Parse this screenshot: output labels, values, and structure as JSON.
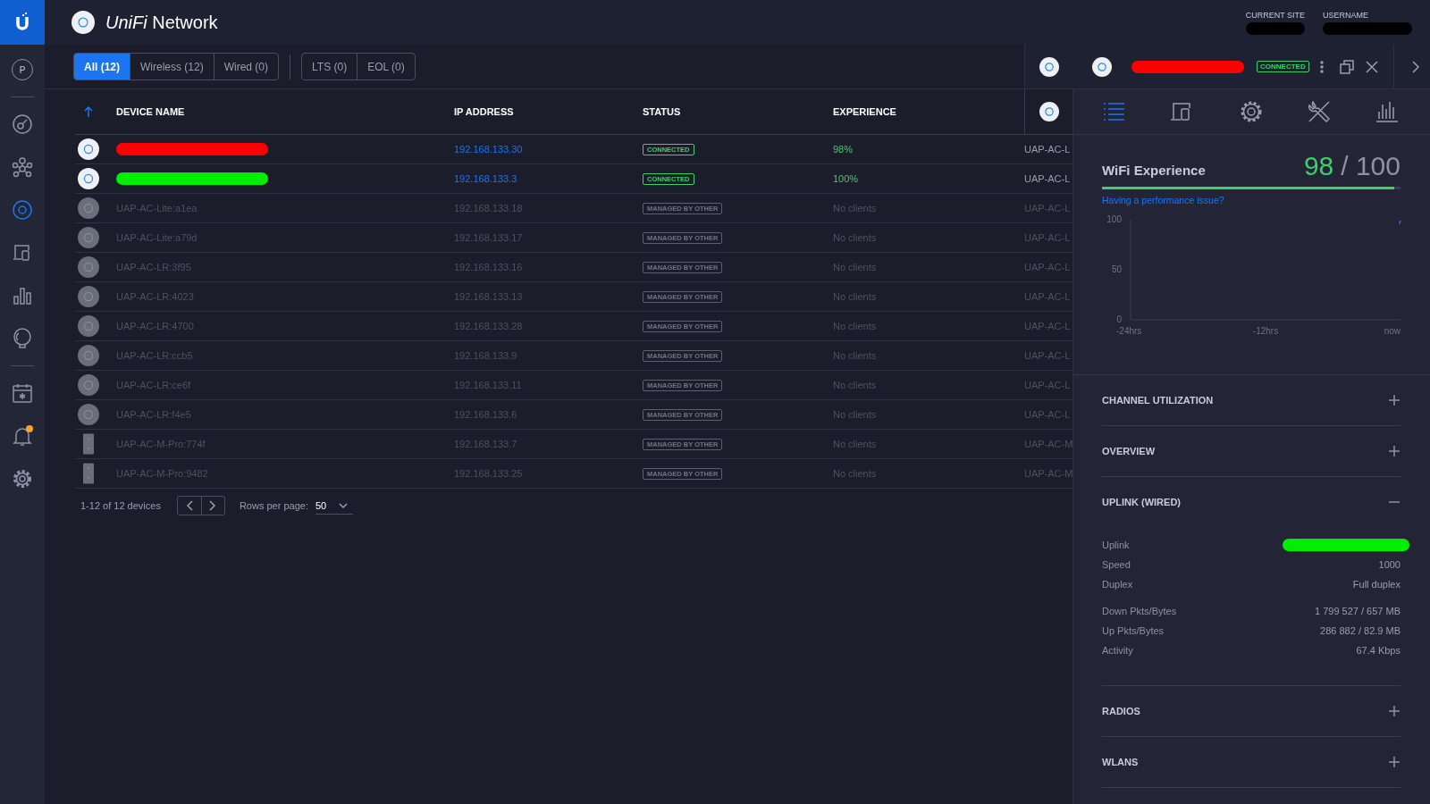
{
  "sidebar": {
    "items": [
      {
        "kind": "logo",
        "selected": false
      },
      {
        "kind": "avatar",
        "label": "P",
        "selected": false
      },
      {
        "kind": "divider"
      },
      {
        "kind": "dashboard",
        "selected": false
      },
      {
        "kind": "topology",
        "selected": false
      },
      {
        "kind": "devices",
        "selected": true
      },
      {
        "kind": "clients",
        "selected": false
      },
      {
        "kind": "statistics",
        "selected": false
      },
      {
        "kind": "insights",
        "selected": false
      },
      {
        "kind": "divider"
      },
      {
        "kind": "events",
        "selected": false
      },
      {
        "kind": "alarms",
        "selected": false,
        "alert": true
      },
      {
        "kind": "settings",
        "selected": false
      }
    ]
  },
  "header": {
    "product": "*UniFi* Network",
    "site": {
      "label": "CURRENT SITE",
      "redaction": {
        "color": "#000000"
      }
    },
    "user": {
      "label": "USERNAME",
      "redaction": {
        "color": "#000000"
      }
    }
  },
  "filters": {
    "groups": [
      [
        {
          "label": "All (12)",
          "selected": true
        },
        {
          "label": "Wireless (12)",
          "selected": false
        },
        {
          "label": "Wired (0)",
          "selected": false
        }
      ],
      [
        {
          "label": "LTS (0)",
          "selected": false
        },
        {
          "label": "EOL (0)",
          "selected": false
        }
      ]
    ]
  },
  "table": {
    "columns": [
      {
        "label": "DEVICE NAME",
        "sorted": true
      },
      {
        "label": "IP ADDRESS"
      },
      {
        "label": "STATUS"
      },
      {
        "label": "EXPERIENCE"
      },
      {
        "kind": "icon"
      }
    ],
    "rows": [
      {
        "kind": "round",
        "redaction": {
          "color": "#ff0000"
        },
        "ip": "192.168.133.30",
        "status": {
          "label": "CONNECTED",
          "kind": "connected"
        },
        "experience": "98%",
        "model": "UAP-AC-L"
      },
      {
        "kind": "round",
        "redaction": {
          "color": "#00ee00"
        },
        "ip": "192.168.133.3",
        "status": {
          "label": "CONNECTED",
          "kind": "connected"
        },
        "experience": "100%",
        "model": "UAP-AC-L"
      },
      {
        "kind": "round",
        "name": "UAP-AC-Lite:a1ea",
        "ip": "192.168.133.18",
        "status": {
          "label": "MANAGED BY OTHER",
          "kind": "managed"
        },
        "experience": "No clients",
        "model": "UAP-AC-L"
      },
      {
        "kind": "round",
        "name": "UAP-AC-Lite:a79d",
        "ip": "192.168.133.17",
        "status": {
          "label": "MANAGED BY OTHER",
          "kind": "managed"
        },
        "experience": "No clients",
        "model": "UAP-AC-L"
      },
      {
        "kind": "round",
        "name": "UAP-AC-LR:3f95",
        "ip": "192.168.133.16",
        "status": {
          "label": "MANAGED BY OTHER",
          "kind": "managed"
        },
        "experience": "No clients",
        "model": "UAP-AC-L"
      },
      {
        "kind": "round",
        "name": "UAP-AC-LR:4023",
        "ip": "192.168.133.13",
        "status": {
          "label": "MANAGED BY OTHER",
          "kind": "managed"
        },
        "experience": "No clients",
        "model": "UAP-AC-L"
      },
      {
        "kind": "round",
        "name": "UAP-AC-LR:4700",
        "ip": "192.168.133.28",
        "status": {
          "label": "MANAGED BY OTHER",
          "kind": "managed"
        },
        "experience": "No clients",
        "model": "UAP-AC-L"
      },
      {
        "kind": "round",
        "name": "UAP-AC-LR:ccb5",
        "ip": "192.168.133.9",
        "status": {
          "label": "MANAGED BY OTHER",
          "kind": "managed"
        },
        "experience": "No clients",
        "model": "UAP-AC-L"
      },
      {
        "kind": "round",
        "name": "UAP-AC-LR:ce6f",
        "ip": "192.168.133.11",
        "status": {
          "label": "MANAGED BY OTHER",
          "kind": "managed"
        },
        "experience": "No clients",
        "model": "UAP-AC-L"
      },
      {
        "kind": "round",
        "name": "UAP-AC-LR:f4e5",
        "ip": "192.168.133.6",
        "status": {
          "label": "MANAGED BY OTHER",
          "kind": "managed"
        },
        "experience": "No clients",
        "model": "UAP-AC-L"
      },
      {
        "kind": "tall",
        "name": "UAP-AC-M-Pro:774f",
        "ip": "192.168.133.7",
        "status": {
          "label": "MANAGED BY OTHER",
          "kind": "managed"
        },
        "experience": "No clients",
        "model": "UAP-AC-M"
      },
      {
        "kind": "tall",
        "name": "UAP-AC-M-Pro:9482",
        "ip": "192.168.133.25",
        "status": {
          "label": "MANAGED BY OTHER",
          "kind": "managed"
        },
        "experience": "No clients",
        "model": "UAP-AC-M"
      }
    ]
  },
  "pagination": {
    "summary": "1-12 of 12 devices",
    "rows_label": "Rows per page:",
    "rows_value": "50"
  },
  "panel": {
    "header": {
      "redaction": {
        "color": "#ff0000"
      },
      "status": "CONNECTED"
    },
    "tabs": [
      {
        "kind": "details",
        "selected": true
      },
      {
        "kind": "clients",
        "selected": false
      },
      {
        "kind": "settings",
        "selected": false
      },
      {
        "kind": "tools",
        "selected": false
      },
      {
        "kind": "statistics",
        "selected": false
      }
    ],
    "experience": {
      "title": "WiFi Experience",
      "score": "98",
      "max": "/ 100",
      "level": 0.98,
      "link": "Having a performance issue?",
      "chart_data": {
        "type": "line",
        "x": [
          -0.1,
          0
        ],
        "xlim": [
          -24,
          0
        ],
        "ylim": [
          0,
          100
        ],
        "xticks": [
          {
            "value": -24,
            "label": "-24hrs"
          },
          {
            "value": -12,
            "label": "-12hrs"
          },
          {
            "value": 0,
            "label": "now"
          }
        ],
        "yticks": [
          0,
          50,
          100
        ],
        "series": [
          {
            "color": "#3b6fd4",
            "values": [
              96,
              99
            ]
          }
        ]
      }
    },
    "sections": [
      {
        "title": "CHANNEL UTILIZATION",
        "expanded": false
      },
      {
        "title": "OVERVIEW",
        "expanded": false
      },
      {
        "title": "UPLINK (WIRED)",
        "expanded": true,
        "groups": [
          [
            {
              "label": "Uplink",
              "redaction": {
                "color": "#00ee00"
              }
            },
            {
              "label": "Speed",
              "value": "1000"
            },
            {
              "label": "Duplex",
              "value": "Full duplex"
            }
          ],
          [
            {
              "label": "Down Pkts/Bytes",
              "value": "1 799 527 / 657 MB"
            },
            {
              "label": "Up Pkts/Bytes",
              "value": "286 882 / 82.9 MB"
            },
            {
              "label": "Activity",
              "value": "67.4 Kbps"
            }
          ]
        ]
      },
      {
        "title": "RADIOS",
        "expanded": false
      },
      {
        "title": "WLANS",
        "expanded": false
      }
    ]
  }
}
